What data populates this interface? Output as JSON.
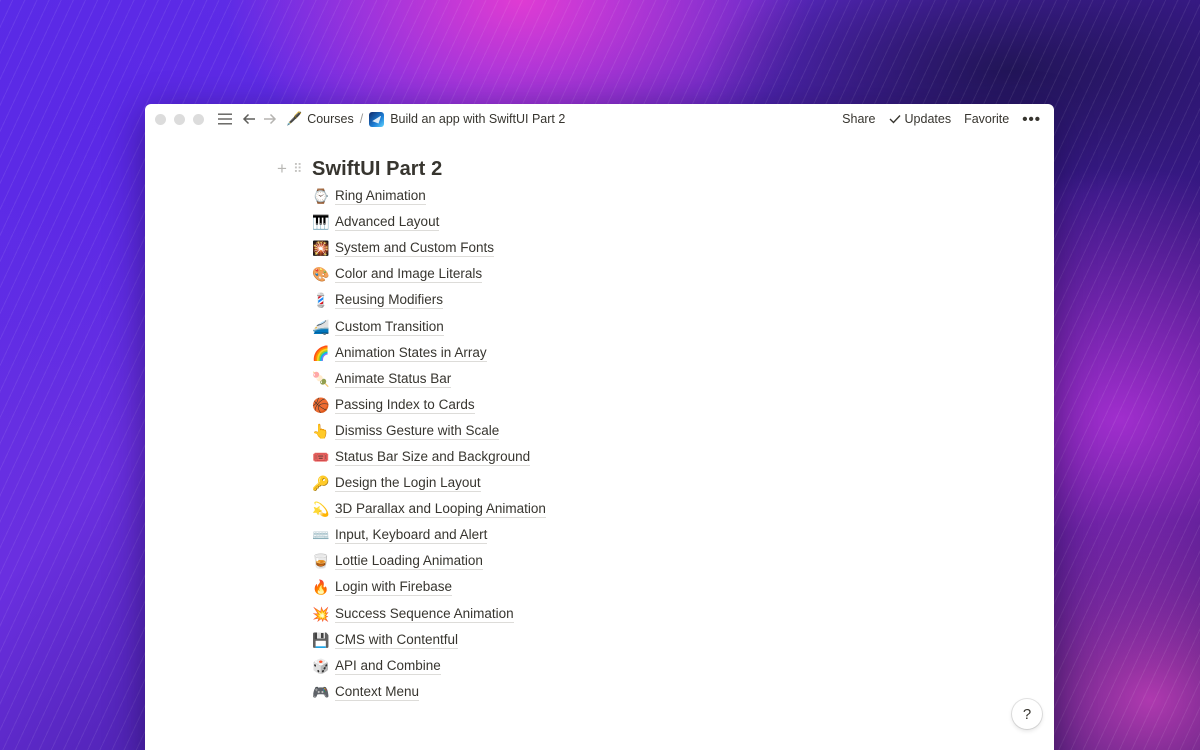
{
  "breadcrumb": {
    "root_emoji": "🖋️",
    "root_label": "Courses",
    "separator": "/",
    "current_label": "Build an app with SwiftUI Part 2"
  },
  "topbar": {
    "share_label": "Share",
    "updates_label": "Updates",
    "favorite_label": "Favorite",
    "more_glyph": "•••"
  },
  "page": {
    "title": "SwiftUI Part 2",
    "items": [
      {
        "emoji": "⌚",
        "label": "Ring Animation"
      },
      {
        "emoji": "🎹",
        "label": "Advanced Layout"
      },
      {
        "emoji": "🎇",
        "label": "System and Custom Fonts"
      },
      {
        "emoji": "🎨",
        "label": "Color and Image Literals"
      },
      {
        "emoji": "💈",
        "label": "Reusing Modifiers"
      },
      {
        "emoji": "🚄",
        "label": "Custom Transition"
      },
      {
        "emoji": "🌈",
        "label": "Animation States in Array"
      },
      {
        "emoji": "🍡",
        "label": "Animate Status Bar"
      },
      {
        "emoji": "🏀",
        "label": "Passing Index to Cards"
      },
      {
        "emoji": "👆",
        "label": "Dismiss Gesture with Scale"
      },
      {
        "emoji": "🎟️",
        "label": "Status Bar Size and Background"
      },
      {
        "emoji": "🔑",
        "label": "Design the Login Layout"
      },
      {
        "emoji": "💫",
        "label": "3D Parallax and Looping Animation"
      },
      {
        "emoji": "⌨️",
        "label": "Input, Keyboard and Alert"
      },
      {
        "emoji": "🥃",
        "label": "Lottie Loading Animation"
      },
      {
        "emoji": "🔥",
        "label": "Login with Firebase"
      },
      {
        "emoji": "💥",
        "label": "Success Sequence Animation"
      },
      {
        "emoji": "💾",
        "label": "CMS with Contentful"
      },
      {
        "emoji": "🎲",
        "label": "API and Combine"
      },
      {
        "emoji": "🎮",
        "label": "Context Menu"
      }
    ]
  },
  "help": {
    "label": "?"
  }
}
